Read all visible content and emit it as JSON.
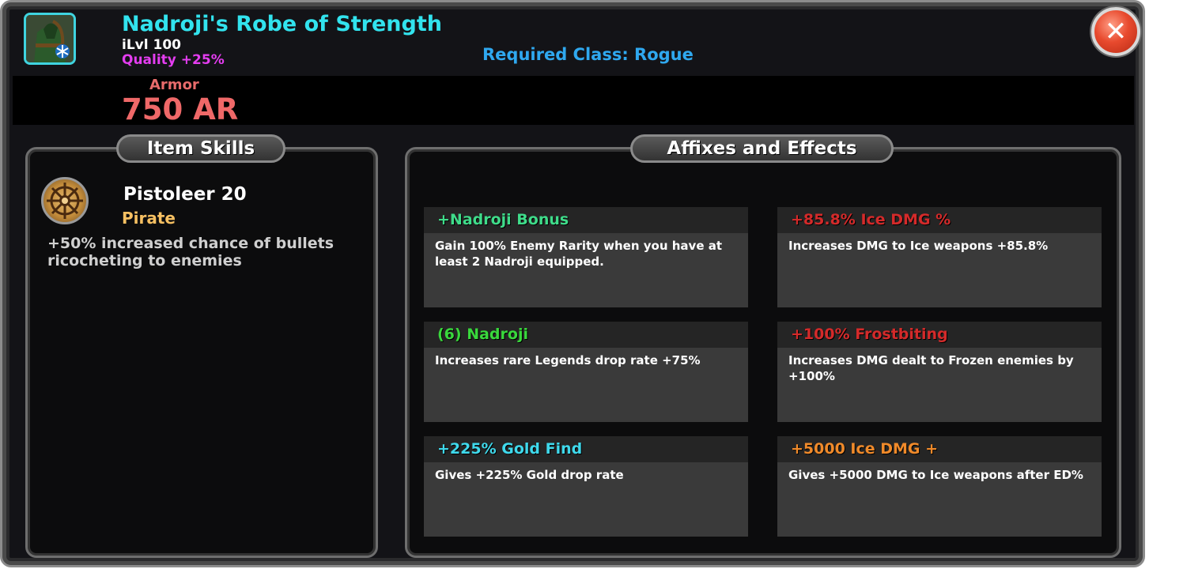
{
  "item": {
    "name": "Nadroji's Robe of Strength",
    "ilvl": "iLvl 100",
    "quality": "Quality +25%",
    "required_class": "Required Class: Rogue",
    "icon": "robe-icon",
    "stat_label": "Armor",
    "stat_value": "750 AR"
  },
  "close_icon": "close-icon",
  "skills_panel": {
    "tab_label": "Item Skills",
    "skills": [
      {
        "icon": "ship-wheel-icon",
        "name": "Pistoleer 20",
        "category": "Pirate",
        "description": "+50% increased chance of bullets ricocheting to enemies"
      }
    ]
  },
  "affixes_panel": {
    "tab_label": "Affixes and Effects",
    "affixes": [
      {
        "title": "+Nadroji Bonus",
        "color": "#3fdc8a",
        "description": "Gain 100% Enemy Rarity when you have at least 2 Nadroji equipped."
      },
      {
        "title": "+85.8% Ice DMG %",
        "color": "#d42a2a",
        "description": "Increases DMG to Ice weapons +85.8%"
      },
      {
        "title": "(6) Nadroji",
        "color": "#39d83c",
        "description": "Increases rare Legends drop rate +75%"
      },
      {
        "title": "+100% Frostbiting",
        "color": "#d42a2a",
        "description": "Increases DMG dealt to Frozen enemies by +100%"
      },
      {
        "title": "+225% Gold Find",
        "color": "#3fd9ec",
        "description": "Gives +225% Gold drop rate"
      },
      {
        "title": "+5000 Ice DMG +",
        "color": "#f08a2a",
        "description": "Gives +5000 DMG to Ice weapons after ED%"
      }
    ]
  }
}
